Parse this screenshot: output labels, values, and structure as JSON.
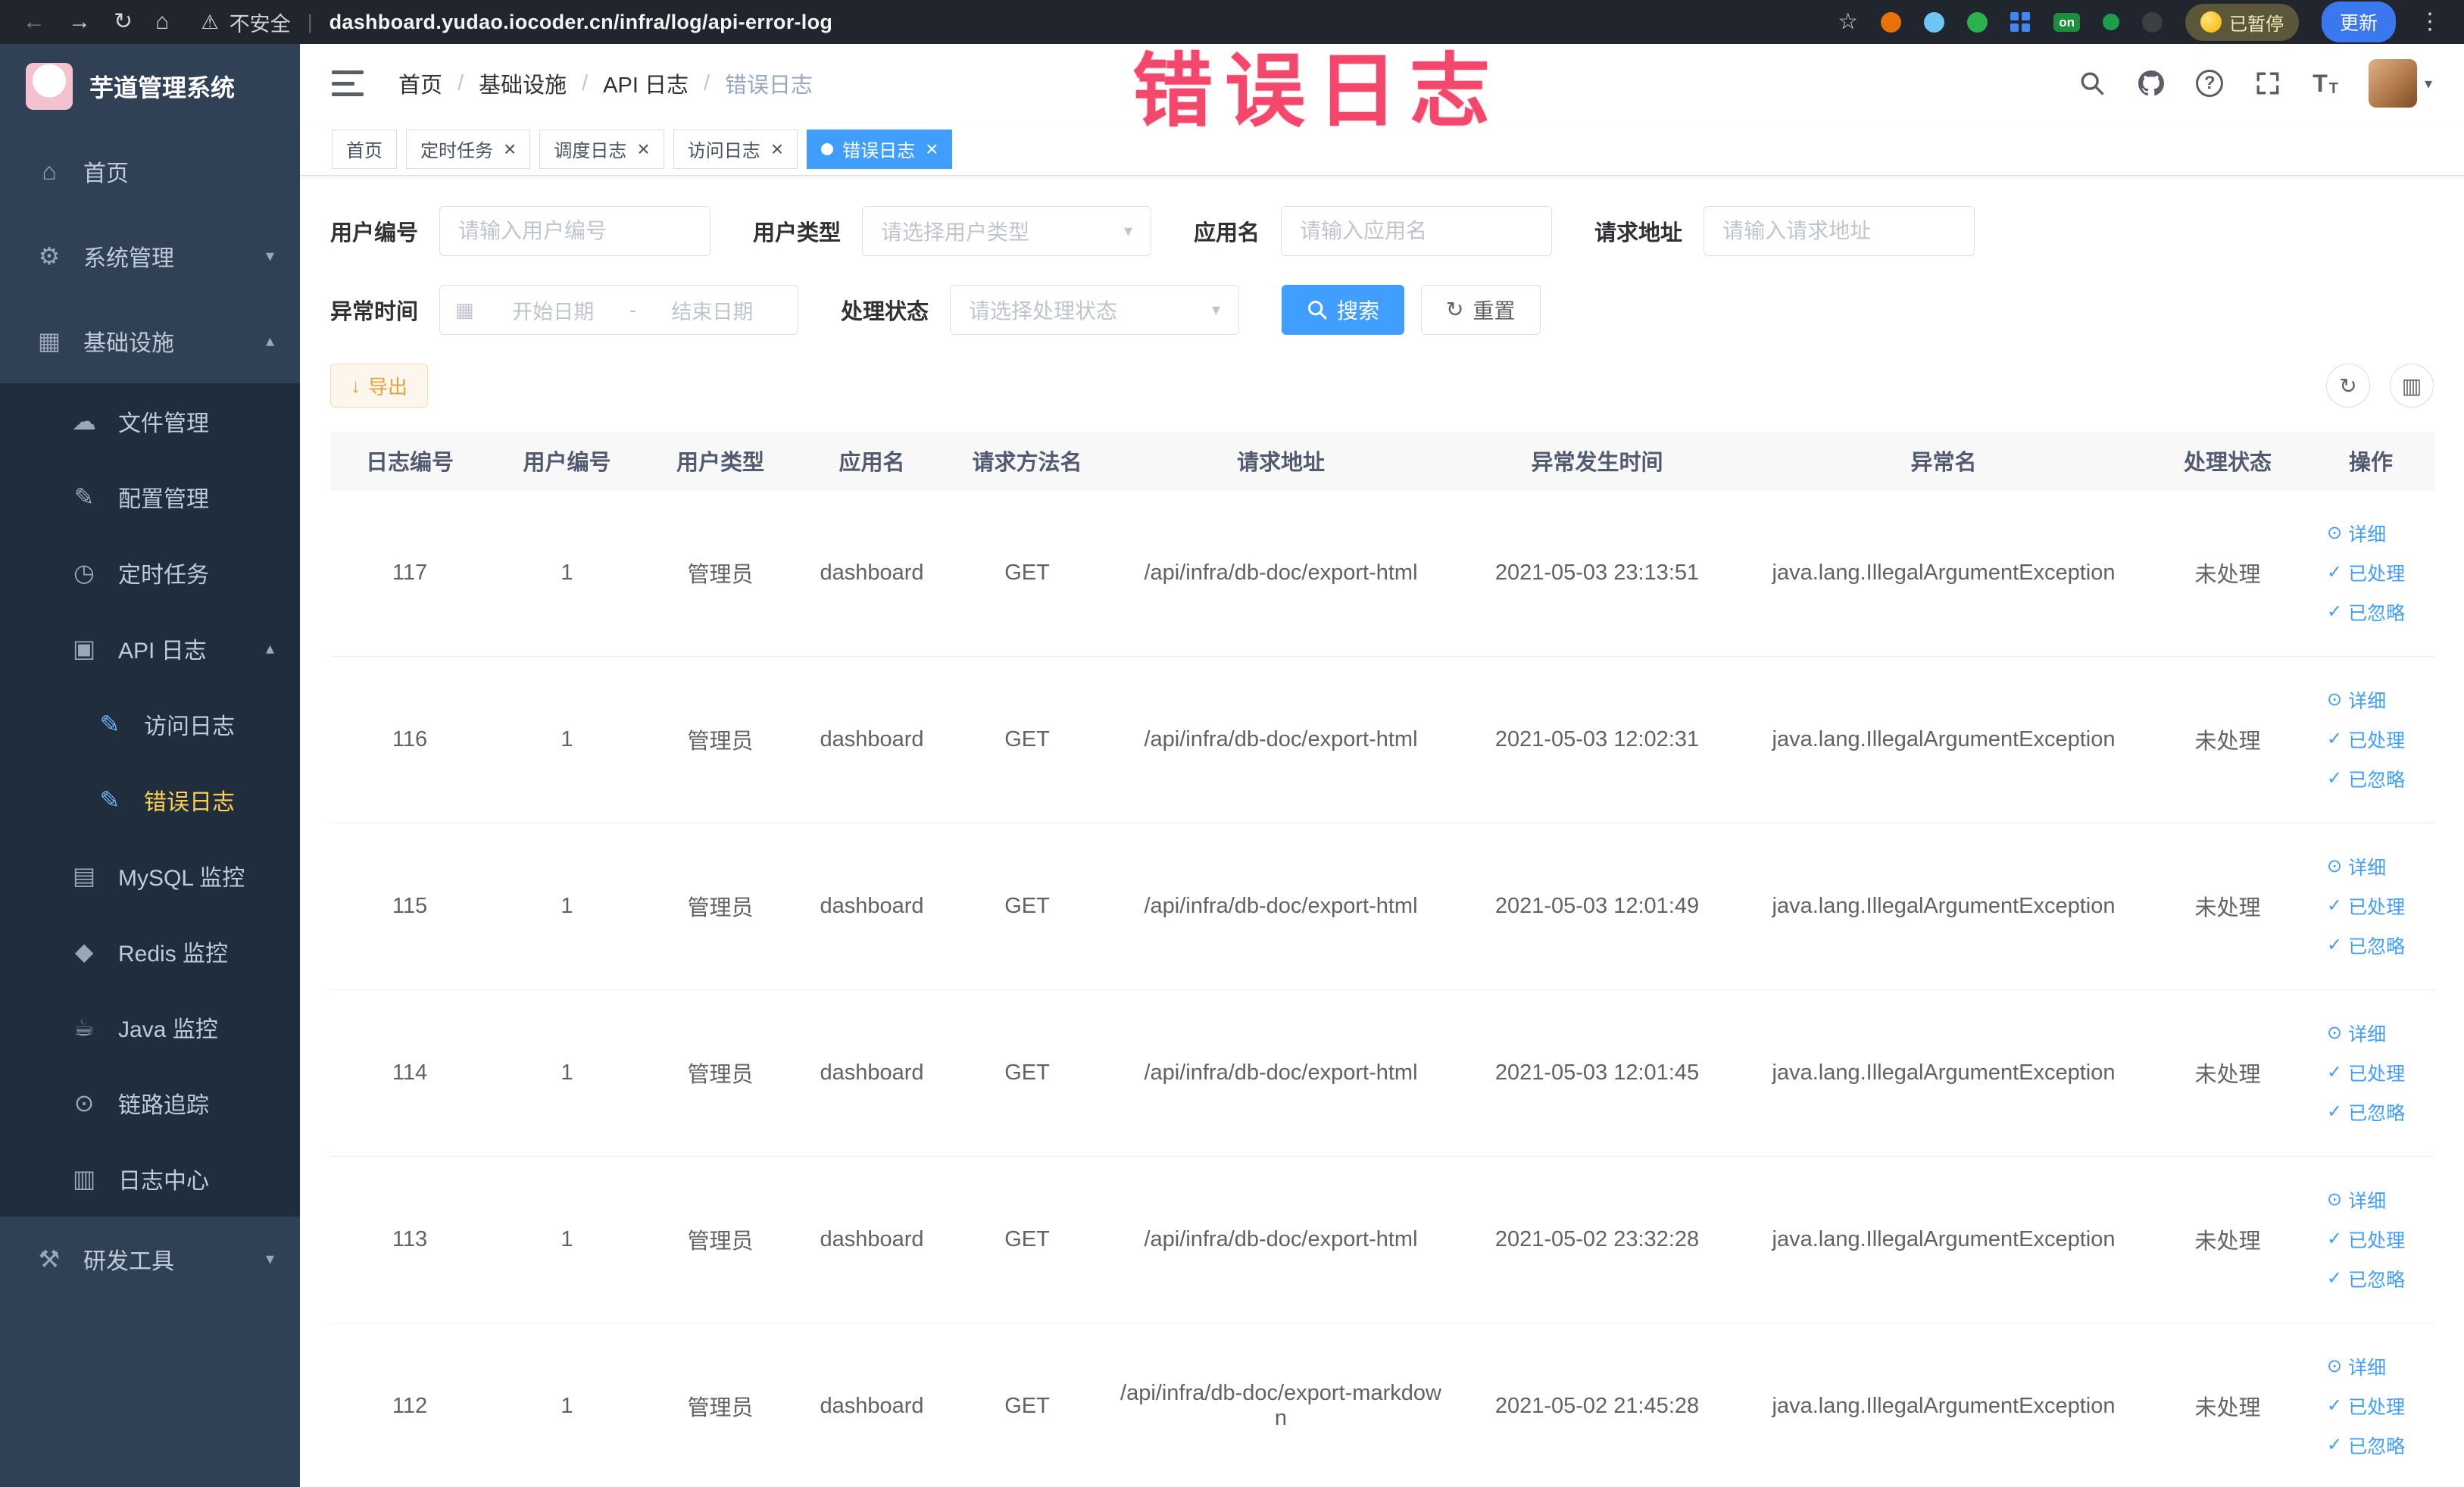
{
  "colors": {
    "accent": "#409EFF",
    "warning": "#e6a23c",
    "sidebar_bg": "#304156",
    "submenu_bg": "#1f2d3d",
    "active_menu_text": "#ffd04b",
    "watermark": "#f3476c"
  },
  "watermark": "错误日志",
  "browser": {
    "security_label": "不安全",
    "url": "dashboard.yudao.iocoder.cn/infra/log/api-error-log",
    "ext_on_badge": "on",
    "paused_badge": "已暂停",
    "update_button": "更新"
  },
  "sidebar": {
    "logo_title": "芋道管理系统",
    "items": [
      {
        "label": "首页",
        "icon": "home-icon",
        "level": 1
      },
      {
        "label": "系统管理",
        "icon": "gear-icon",
        "level": 1,
        "chevron": "down"
      },
      {
        "label": "基础设施",
        "icon": "infrastructure-icon",
        "level": 1,
        "chevron": "up"
      },
      {
        "label": "文件管理",
        "icon": "file-cloud-icon",
        "level": 2,
        "sub": true
      },
      {
        "label": "配置管理",
        "icon": "config-edit-icon",
        "level": 2,
        "sub": true
      },
      {
        "label": "定时任务",
        "icon": "timer-icon",
        "level": 2,
        "sub": true
      },
      {
        "label": "API 日志",
        "icon": "api-log-icon",
        "level": 2,
        "sub": true,
        "chevron": "up"
      },
      {
        "label": "访问日志",
        "icon": "access-log-icon",
        "level": 3,
        "sub": true
      },
      {
        "label": "错误日志",
        "icon": "error-log-icon",
        "level": 3,
        "sub": true,
        "active": true
      },
      {
        "label": "MySQL 监控",
        "icon": "mysql-icon",
        "level": 2,
        "sub": true
      },
      {
        "label": "Redis 监控",
        "icon": "redis-icon",
        "level": 2,
        "sub": true
      },
      {
        "label": "Java 监控",
        "icon": "java-icon",
        "level": 2,
        "sub": true
      },
      {
        "label": "链路追踪",
        "icon": "trace-icon",
        "level": 2,
        "sub": true
      },
      {
        "label": "日志中心",
        "icon": "log-center-icon",
        "level": 2,
        "sub": true
      },
      {
        "label": "研发工具",
        "icon": "tools-icon",
        "level": 1,
        "chevron": "down"
      }
    ]
  },
  "header": {
    "breadcrumb": [
      "首页",
      "基础设施",
      "API 日志",
      "错误日志"
    ]
  },
  "tabs": [
    {
      "label": "首页",
      "closable": false,
      "active": false
    },
    {
      "label": "定时任务",
      "closable": true,
      "active": false
    },
    {
      "label": "调度日志",
      "closable": true,
      "active": false
    },
    {
      "label": "访问日志",
      "closable": true,
      "active": false
    },
    {
      "label": "错误日志",
      "closable": true,
      "active": true
    }
  ],
  "filters": {
    "user_id": {
      "label": "用户编号",
      "placeholder": "请输入用户编号"
    },
    "user_type": {
      "label": "用户类型",
      "placeholder": "请选择用户类型"
    },
    "app_name": {
      "label": "应用名",
      "placeholder": "请输入应用名"
    },
    "request_url": {
      "label": "请求地址",
      "placeholder": "请输入请求地址"
    },
    "exception_time": {
      "label": "异常时间",
      "start_placeholder": "开始日期",
      "end_placeholder": "结束日期",
      "separator": "-"
    },
    "process_status": {
      "label": "处理状态",
      "placeholder": "请选择处理状态"
    },
    "search_button": "搜索",
    "reset_button": "重置"
  },
  "toolbar": {
    "export_label": "导出"
  },
  "table": {
    "columns": [
      "日志编号",
      "用户编号",
      "用户类型",
      "应用名",
      "请求方法名",
      "请求地址",
      "异常发生时间",
      "异常名",
      "处理状态",
      "操作"
    ],
    "actions": [
      {
        "label": "详细",
        "icon": "eye-icon"
      },
      {
        "label": "已处理",
        "icon": "check-icon"
      },
      {
        "label": "已忽略",
        "icon": "check-icon"
      }
    ],
    "rows": [
      {
        "id": "117",
        "user_id": "1",
        "user_type": "管理员",
        "app": "dashboard",
        "method": "GET",
        "url": "/api/infra/db-doc/export-html",
        "time": "2021-05-03 23:13:51",
        "exception": "java.lang.IllegalArgumentException",
        "status": "未处理"
      },
      {
        "id": "116",
        "user_id": "1",
        "user_type": "管理员",
        "app": "dashboard",
        "method": "GET",
        "url": "/api/infra/db-doc/export-html",
        "time": "2021-05-03 12:02:31",
        "exception": "java.lang.IllegalArgumentException",
        "status": "未处理"
      },
      {
        "id": "115",
        "user_id": "1",
        "user_type": "管理员",
        "app": "dashboard",
        "method": "GET",
        "url": "/api/infra/db-doc/export-html",
        "time": "2021-05-03 12:01:49",
        "exception": "java.lang.IllegalArgumentException",
        "status": "未处理"
      },
      {
        "id": "114",
        "user_id": "1",
        "user_type": "管理员",
        "app": "dashboard",
        "method": "GET",
        "url": "/api/infra/db-doc/export-html",
        "time": "2021-05-03 12:01:45",
        "exception": "java.lang.IllegalArgumentException",
        "status": "未处理"
      },
      {
        "id": "113",
        "user_id": "1",
        "user_type": "管理员",
        "app": "dashboard",
        "method": "GET",
        "url": "/api/infra/db-doc/export-html",
        "time": "2021-05-02 23:32:28",
        "exception": "java.lang.IllegalArgumentException",
        "status": "未处理"
      },
      {
        "id": "112",
        "user_id": "1",
        "user_type": "管理员",
        "app": "dashboard",
        "method": "GET",
        "url": "/api/infra/db-doc/export-markdown",
        "time": "2021-05-02 21:45:28",
        "exception": "java.lang.IllegalArgumentException",
        "status": "未处理"
      }
    ]
  }
}
